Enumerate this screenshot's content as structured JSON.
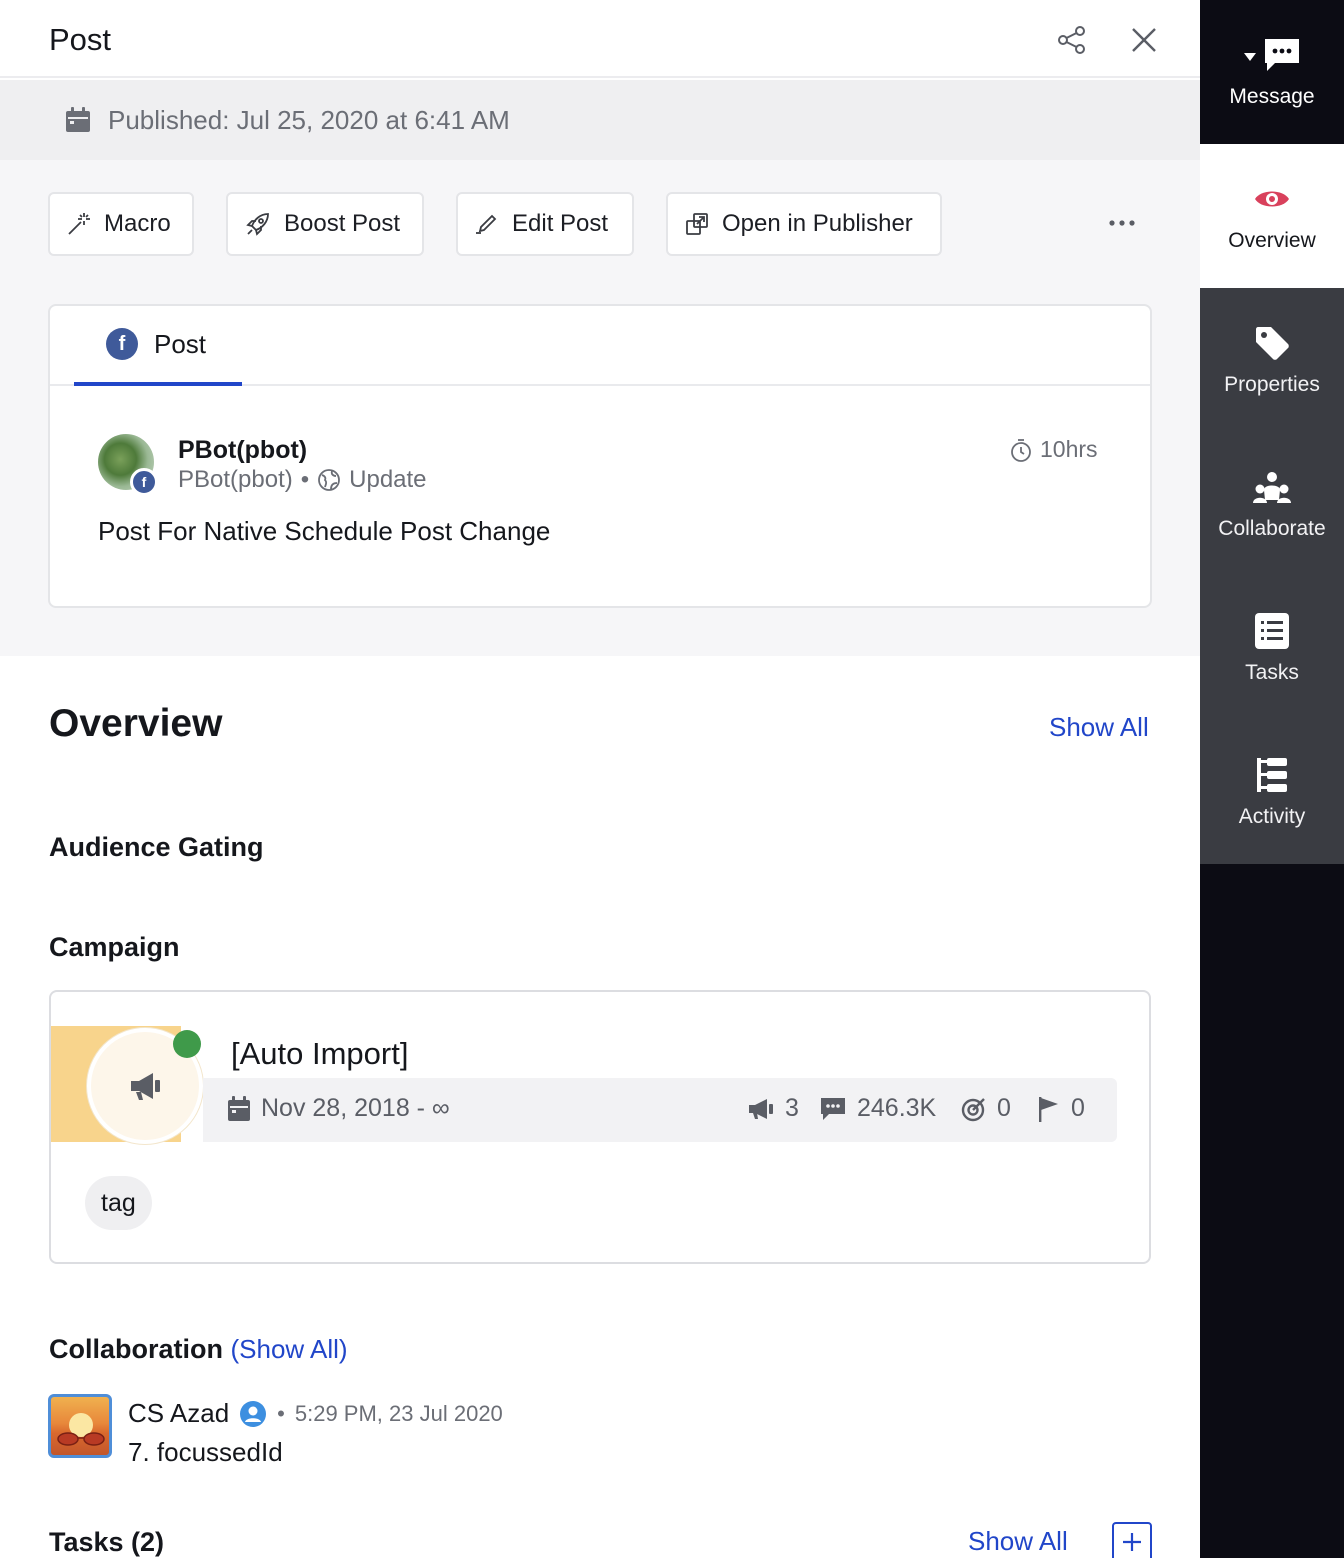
{
  "header": {
    "title": "Post"
  },
  "published": {
    "text": "Published: Jul 25, 2020 at 6:41 AM"
  },
  "actions": {
    "macro": "Macro",
    "boost": "Boost Post",
    "edit": "Edit Post",
    "open": "Open in Publisher"
  },
  "post": {
    "tab_label": "Post",
    "author_name": "PBot(pbot)",
    "author_handle": "PBot(pbot)",
    "post_type": "Update",
    "time_ago": "10hrs",
    "text": "Post For Native Schedule Post Change"
  },
  "overview": {
    "title": "Overview",
    "show_all": "Show All",
    "audience_gating": "Audience Gating",
    "campaign_label": "Campaign"
  },
  "campaign": {
    "name": "[Auto Import]",
    "date_range": "Nov 28, 2018 - ∞",
    "posts": "3",
    "messages": "246.3K",
    "goals": "0",
    "flags": "0",
    "tag": "tag"
  },
  "collaboration": {
    "title": "Collaboration",
    "show_all": "(Show All)",
    "user": "CS Azad",
    "time": "5:29 PM, 23 Jul 2020",
    "message": "7. focussedId"
  },
  "tasks": {
    "title": "Tasks (2)",
    "show_all": "Show All"
  },
  "rail": {
    "message": "Message",
    "overview": "Overview",
    "properties": "Properties",
    "collaborate": "Collaborate",
    "tasks": "Tasks",
    "activity": "Activity"
  },
  "colors": {
    "accent": "#2146c9",
    "facebook": "#3f5a9a",
    "active_dot": "#3f9a4a",
    "overview_icon": "#d9415c",
    "rail_dark": "#0c0c14",
    "rail_mid": "#3a3c42"
  }
}
